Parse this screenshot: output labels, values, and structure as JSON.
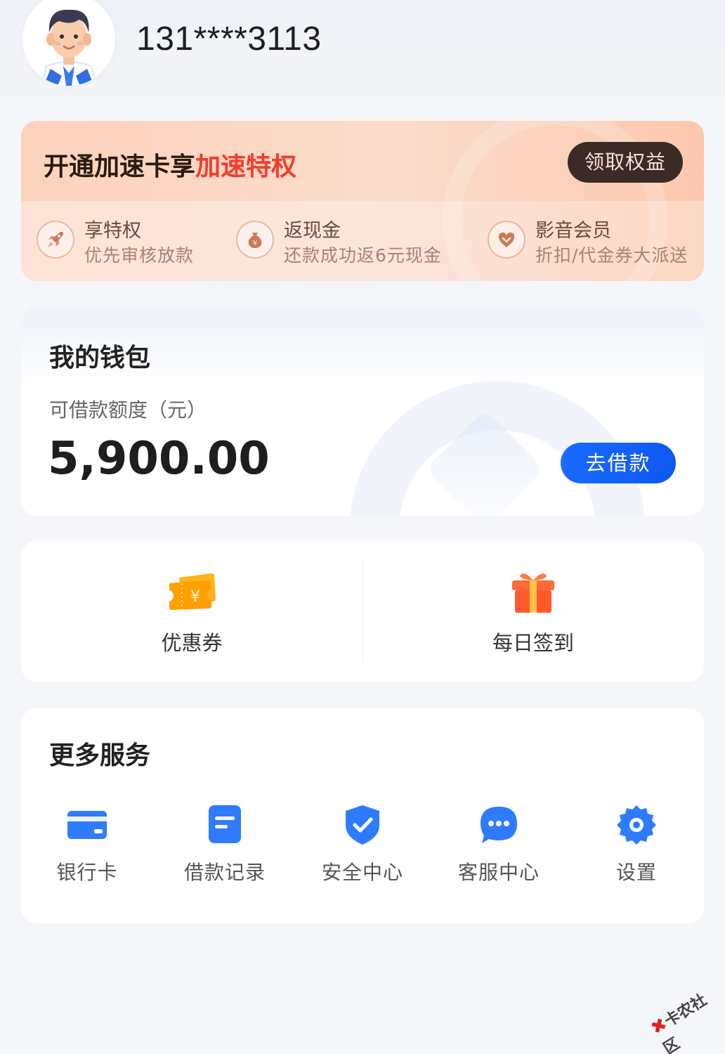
{
  "user": {
    "phone": "131****3113",
    "avatar_icon": "avatar-man-icon"
  },
  "vip_card": {
    "title_prefix": "开通加速卡享",
    "title_highlight": "加速特权",
    "button_label": "领取权益",
    "perks": [
      {
        "icon": "rocket-icon",
        "title": "享特权",
        "subtitle": "优先审核放款"
      },
      {
        "icon": "money-bag-icon",
        "title": "返现金",
        "subtitle": "还款成功返6元现金"
      },
      {
        "icon": "heart-badge-icon",
        "title": "影音会员",
        "subtitle": "折扣/代金券大派送"
      }
    ]
  },
  "wallet": {
    "title": "我的钱包",
    "label": "可借款额度（元）",
    "amount": "5,900.00",
    "button_label": "去借款"
  },
  "quick": [
    {
      "icon": "coupon-icon",
      "label": "优惠券"
    },
    {
      "icon": "gift-icon",
      "label": "每日签到"
    }
  ],
  "services": {
    "title": "更多服务",
    "items": [
      {
        "icon": "bank-card-icon",
        "label": "银行卡"
      },
      {
        "icon": "document-icon",
        "label": "借款记录"
      },
      {
        "icon": "shield-check-icon",
        "label": "安全中心"
      },
      {
        "icon": "chat-bubble-icon",
        "label": "客服中心"
      },
      {
        "icon": "gear-icon",
        "label": "设置"
      }
    ]
  },
  "watermark": {
    "text": "卡农社区"
  },
  "colors": {
    "accent_blue": "#0b58f3",
    "highlight_red": "#f23c2c",
    "vip_button": "#3a2b27",
    "icon_blue": "#2f7bff"
  }
}
